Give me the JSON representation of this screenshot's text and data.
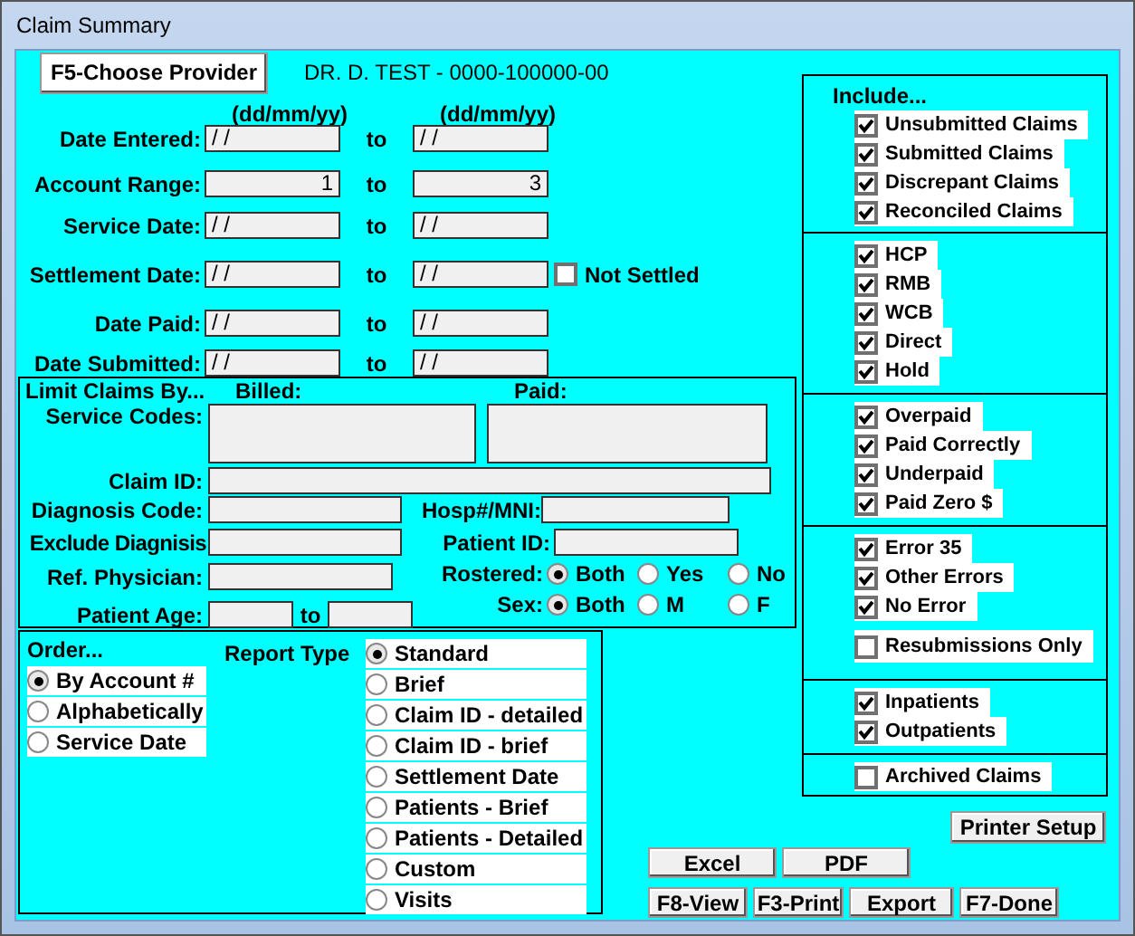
{
  "window": {
    "title": "Claim Summary"
  },
  "provider": {
    "button": "F5-Choose Provider",
    "name": "DR. D. TEST - 0000-100000-00"
  },
  "date_format_labels": [
    "(dd/mm/yy)",
    "(dd/mm/yy)"
  ],
  "ranges": [
    {
      "label": "Date Entered:",
      "kind": "date",
      "from": "/ /",
      "to_label": "to",
      "to": "/ /"
    },
    {
      "label": "Account Range:",
      "kind": "number",
      "from": "1",
      "to_label": "to",
      "to": "3"
    },
    {
      "label": "Service Date:",
      "kind": "date",
      "from": "/ /",
      "to_label": "to",
      "to": "/ /"
    },
    {
      "label": "Settlement Date:",
      "kind": "date",
      "from": "/ /",
      "to_label": "to",
      "to": "/ /",
      "checkbox": {
        "label": "Not Settled",
        "checked": false
      }
    },
    {
      "label": "Date Paid:",
      "kind": "date",
      "from": "/ /",
      "to_label": "to",
      "to": "/ /"
    },
    {
      "label": "Date Submitted:",
      "kind": "date",
      "from": "/ /",
      "to_label": "to",
      "to": "/ /"
    }
  ],
  "limit": {
    "title": "Limit Claims By...",
    "billed_label": "Billed:",
    "paid_label": "Paid:",
    "service_codes_label": "Service Codes:",
    "claim_id_label": "Claim ID:",
    "diagnosis_code_label": "Diagnosis Code:",
    "hosp_label": "Hosp#/MNI:",
    "exclude_label": "Exclude Diagnisis",
    "patient_id_label": "Patient ID:",
    "ref_physician_label": "Ref. Physician:",
    "patient_age_label": "Patient Age:",
    "age_to": "to",
    "rostered": {
      "label": "Rostered:",
      "options": [
        {
          "label": "Both",
          "selected": true
        },
        {
          "label": "Yes",
          "selected": false
        },
        {
          "label": "No",
          "selected": false
        }
      ]
    },
    "sex": {
      "label": "Sex:",
      "options": [
        {
          "label": "Both",
          "selected": true
        },
        {
          "label": "M",
          "selected": false
        },
        {
          "label": "F",
          "selected": false
        }
      ]
    }
  },
  "order": {
    "title": "Order...",
    "options": [
      {
        "label": "By Account #",
        "selected": true
      },
      {
        "label": "Alphabetically",
        "selected": false
      },
      {
        "label": "Service Date",
        "selected": false
      }
    ]
  },
  "report_type": {
    "title": "Report Type",
    "options": [
      {
        "label": "Standard",
        "selected": true
      },
      {
        "label": "Brief",
        "selected": false
      },
      {
        "label": "Claim ID - detailed",
        "selected": false
      },
      {
        "label": "Claim ID - brief",
        "selected": false
      },
      {
        "label": "Settlement Date",
        "selected": false
      },
      {
        "label": "Patients - Brief",
        "selected": false
      },
      {
        "label": "Patients - Detailed",
        "selected": false
      },
      {
        "label": "Custom",
        "selected": false
      },
      {
        "label": "Visits",
        "selected": false
      }
    ]
  },
  "include": {
    "title": "Include...",
    "groups": [
      {
        "items": [
          {
            "label": "Unsubmitted Claims",
            "checked": true
          },
          {
            "label": "Submitted Claims",
            "checked": true
          },
          {
            "label": "Discrepant Claims",
            "checked": true
          },
          {
            "label": "Reconciled Claims",
            "checked": true
          }
        ]
      },
      {
        "items": [
          {
            "label": "HCP",
            "checked": true
          },
          {
            "label": "RMB",
            "checked": true
          },
          {
            "label": "WCB",
            "checked": true
          },
          {
            "label": "Direct",
            "checked": true
          },
          {
            "label": "Hold",
            "checked": true
          }
        ]
      },
      {
        "items": [
          {
            "label": "Overpaid",
            "checked": true
          },
          {
            "label": "Paid Correctly",
            "checked": true
          },
          {
            "label": "Underpaid",
            "checked": true
          },
          {
            "label": "Paid Zero $",
            "checked": true
          }
        ]
      },
      {
        "items": [
          {
            "label": "Error 35",
            "checked": true
          },
          {
            "label": "Other Errors",
            "checked": true
          },
          {
            "label": "No Error",
            "checked": true
          }
        ],
        "footer": {
          "label": "Resubmissions Only",
          "checked": false
        }
      },
      {
        "items": [
          {
            "label": "Inpatients",
            "checked": true
          },
          {
            "label": "Outpatients",
            "checked": true
          }
        ]
      },
      {
        "items": [
          {
            "label": "Archived Claims",
            "checked": false
          }
        ]
      }
    ]
  },
  "printer_setup": "Printer Setup",
  "export_buttons": [
    "Excel",
    "PDF"
  ],
  "action_buttons": [
    "F8-View",
    "F3-Print",
    "Export",
    "F7-Done"
  ]
}
